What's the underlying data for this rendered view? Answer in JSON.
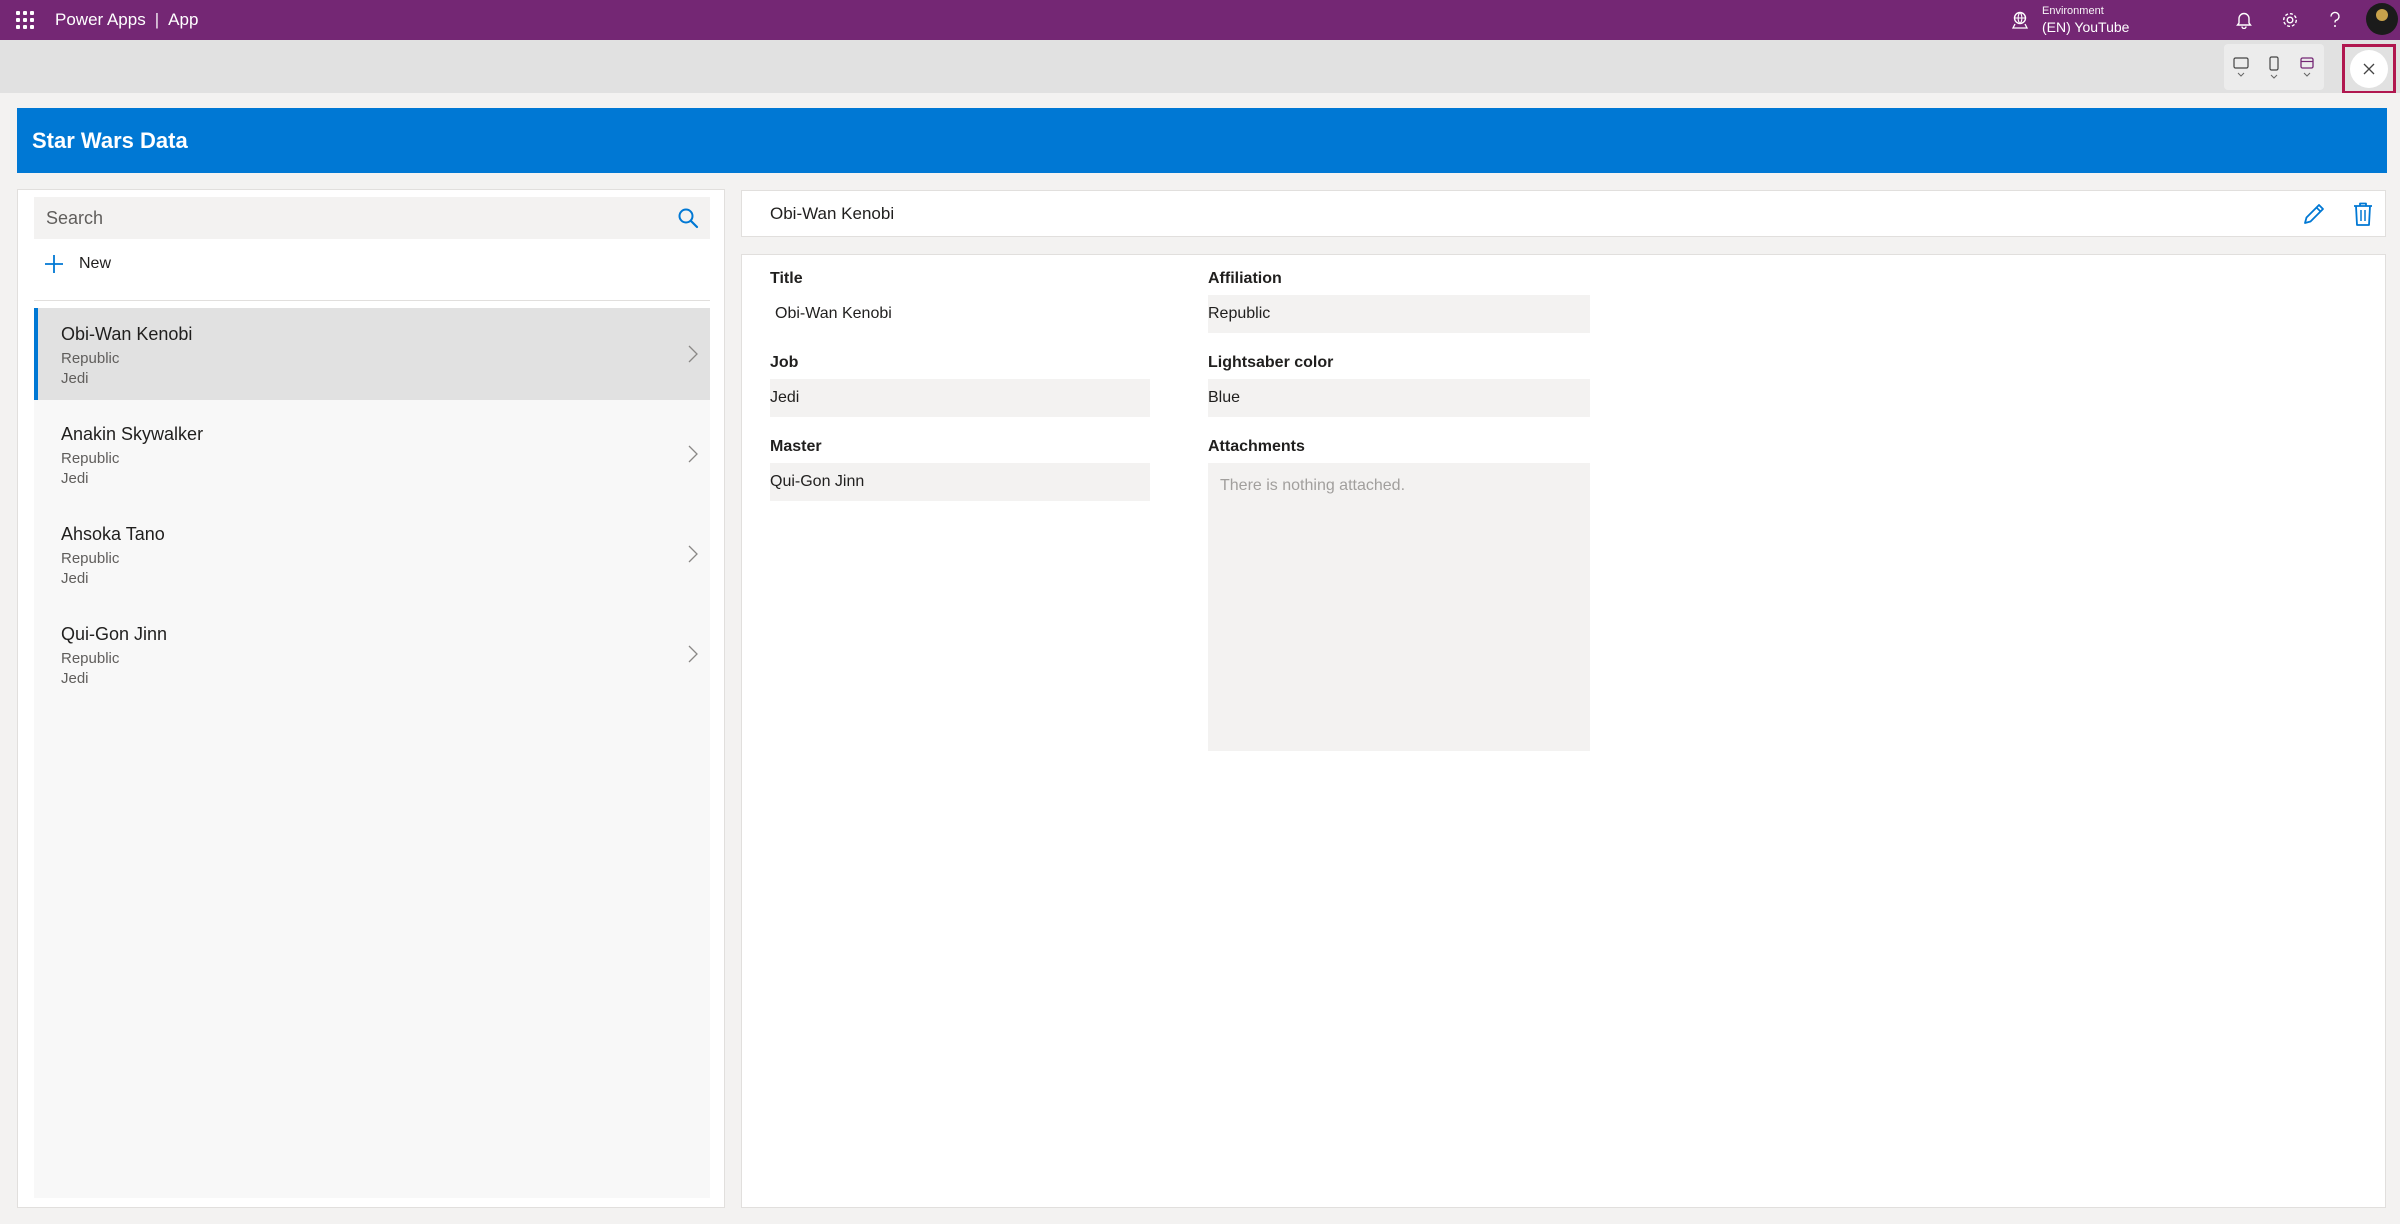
{
  "topbar": {
    "app_name": "Power Apps",
    "separator": "|",
    "app_label": "App",
    "environment_label": "Environment",
    "environment_name": "(EN) YouTube"
  },
  "app": {
    "title": "Star Wars Data"
  },
  "search": {
    "placeholder": "Search"
  },
  "new_button": {
    "label": "New"
  },
  "items": [
    {
      "name": "Obi-Wan Kenobi",
      "affiliation": "Republic",
      "job": "Jedi",
      "selected": true
    },
    {
      "name": "Anakin Skywalker",
      "affiliation": "Republic",
      "job": "Jedi",
      "selected": false
    },
    {
      "name": "Ahsoka Tano",
      "affiliation": "Republic",
      "job": "Jedi",
      "selected": false
    },
    {
      "name": "Qui-Gon Jinn",
      "affiliation": "Republic",
      "job": "Jedi",
      "selected": false
    }
  ],
  "detail": {
    "header_title": "Obi-Wan Kenobi",
    "title_label": "Title",
    "title_value": "Obi-Wan Kenobi",
    "job_label": "Job",
    "job_value": "Jedi",
    "master_label": "Master",
    "master_value": "Qui-Gon Jinn",
    "affiliation_label": "Affiliation",
    "affiliation_value": "Republic",
    "lightsaber_label": "Lightsaber color",
    "lightsaber_value": "Blue",
    "attachments_label": "Attachments",
    "attachments_empty": "There is nothing attached."
  },
  "colors": {
    "suite_bar": "#742774",
    "app_header": "#0078d4",
    "accent": "#0078d4",
    "close_highlight": "#b0174f"
  }
}
